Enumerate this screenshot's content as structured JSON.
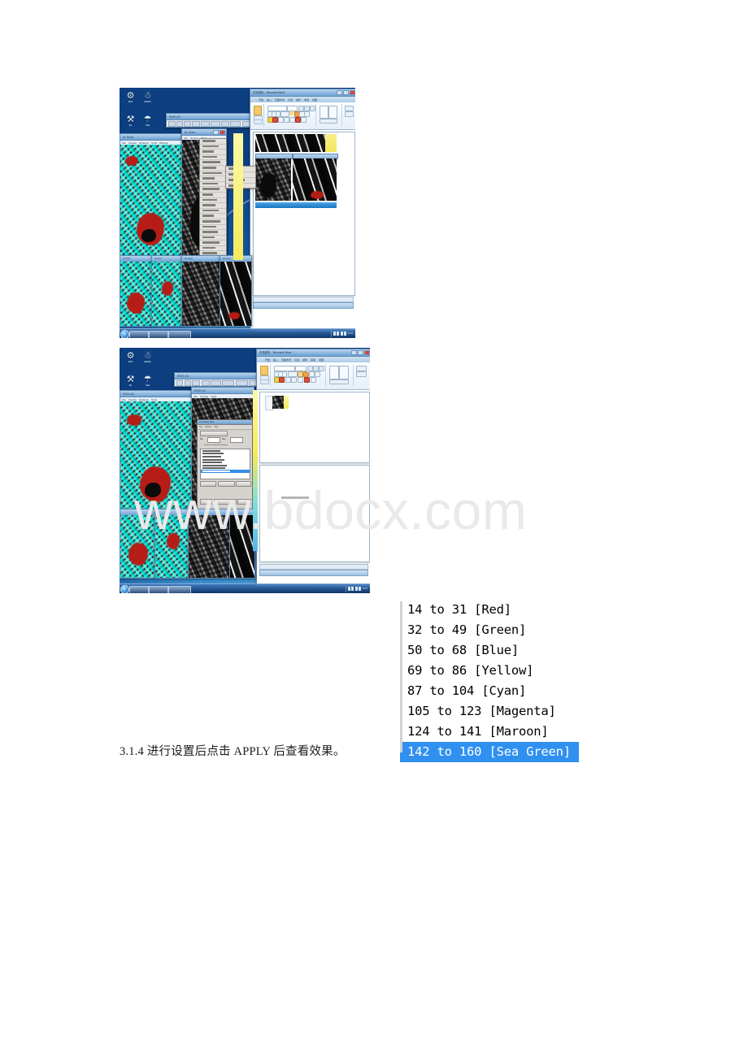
{
  "document": {
    "watermark": "www.bdocx.com",
    "caption": "3.1.4 进行设置后点击 APPLY 后查看效果。"
  },
  "density_slice_list": {
    "name": "Density Slice Ranges",
    "selected_index": 7,
    "highlight_color": "#2f90f0",
    "rows": [
      "14 to 31 [Red]",
      "32 to 49 [Green]",
      "50 to 68 [Blue]",
      "69 to 86 [Yellow]",
      "87 to 104 [Cyan]",
      "105 to 123 [Magenta]",
      "124 to 141 [Maroon]",
      "142 to 160 [Sea Green]"
    ]
  },
  "screenshot_one": {
    "desktop_icons": [
      {
        "glyph": "☗",
        "caption": "ENVI"
      },
      {
        "glyph": "⚱",
        "caption": "ERDAS"
      },
      {
        "glyph": "⚙",
        "caption": "IDL"
      },
      {
        "glyph": "⚱",
        "caption": "Tools"
      }
    ],
    "envi_main": {
      "title": "ENVI 4.8"
    },
    "word_window": {
      "title": "实验报告 - Microsoft Word",
      "ribbon_tabs": [
        "开始",
        "插入",
        "页面布局",
        "引用",
        "邮件",
        "审阅",
        "视图"
      ]
    },
    "display_windows": [
      {
        "title": "#1 Scroll"
      },
      {
        "title": "#1 Zoom"
      },
      {
        "title": "#2 Image"
      },
      {
        "title": "#2 Zoom"
      }
    ],
    "context_menu_items": [
      "Basic Tools",
      "Classification",
      "Transform",
      "Filter",
      "Spectral",
      "Map",
      "Vector",
      "Topographic",
      "Radar",
      "Window",
      "Help"
    ],
    "submenu_items": [
      "Color Mapping",
      "Quick Filter",
      "Density Slice…",
      "Interactive Stretching"
    ],
    "taskbar": {
      "clock": "10:24"
    }
  },
  "screenshot_two": {
    "desktop_icons": [
      {
        "glyph": "☗",
        "caption": "ENVI"
      },
      {
        "glyph": "⚱",
        "caption": "ERDAS"
      },
      {
        "glyph": "⚙",
        "caption": "IDL"
      },
      {
        "glyph": "⚱",
        "caption": "Tools"
      }
    ],
    "envi_main": {
      "title": "ENVI 4.8"
    },
    "word_window": {
      "title": "实验报告 - Microsoft Word",
      "ribbon_tabs": [
        "开始",
        "插入",
        "页面布局",
        "引用",
        "邮件",
        "审阅",
        "视图"
      ]
    },
    "density_dialog": {
      "title": "#1 Density Slice",
      "section_label": "Density Slice Band",
      "min_label": "Min",
      "max_label": "Max",
      "list_header": "Defined Density Slice Ranges",
      "rows": [
        "14 to 31 [Red]",
        "32 to 49 [Green]",
        "50 to 68 [Blue]",
        "69 to 86 [Yellow]",
        "87 to 104 [Cyan]",
        "105 to 123 [Magenta]",
        "124 to 141 [Maroon]",
        "142 to 160 [Sea Green]"
      ],
      "selected_index": 7,
      "buttons": [
        "Clear Ranges",
        "Delete Range",
        "Edit Range"
      ],
      "footer_buttons": [
        "Apply",
        "Reset Stepping",
        "Cancel"
      ]
    },
    "taskbar": {
      "clock": "10:31"
    }
  }
}
